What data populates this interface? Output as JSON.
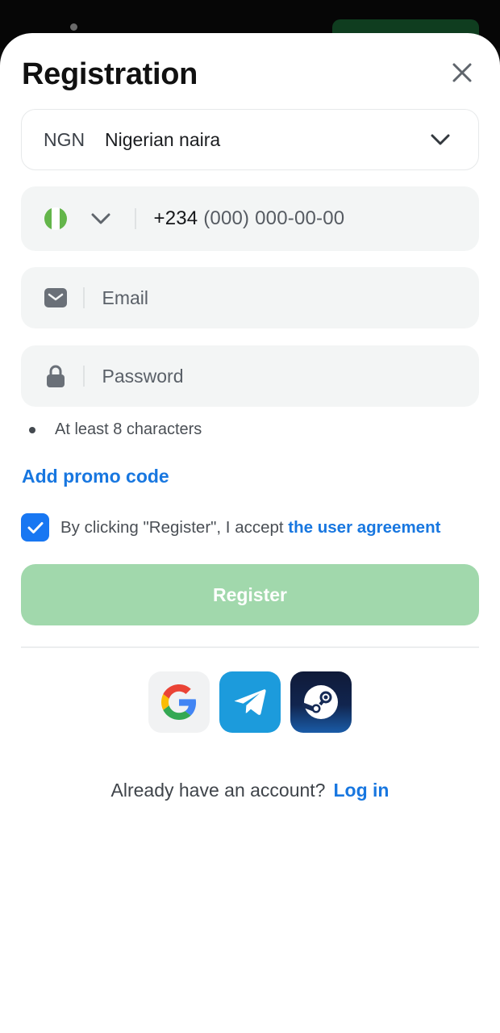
{
  "modal": {
    "title": "Registration"
  },
  "currency": {
    "code": "NGN",
    "name": "Nigerian naira"
  },
  "phone": {
    "prefix": "+234",
    "mask": " (000) 000-00-00"
  },
  "email": {
    "placeholder": "Email"
  },
  "password": {
    "placeholder": "Password",
    "hint": "At least 8 characters"
  },
  "promo": {
    "label": "Add promo code"
  },
  "agreement": {
    "checked": true,
    "text": "By clicking \"Register\", I accept ",
    "link": "the user agreement"
  },
  "register": {
    "label": "Register"
  },
  "social": [
    {
      "name": "google-icon"
    },
    {
      "name": "telegram-icon"
    },
    {
      "name": "steam-icon"
    }
  ],
  "login": {
    "question": "Already have an account?",
    "link": "Log in"
  },
  "colors": {
    "accent": "#1877e0",
    "register_disabled": "#a1d8ac",
    "field_bg": "#f3f5f5",
    "checkbox": "#1877f2"
  }
}
